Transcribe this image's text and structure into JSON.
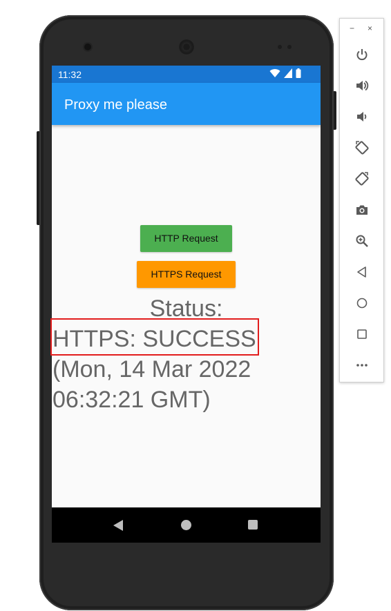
{
  "status_bar": {
    "time": "11:32"
  },
  "app_bar": {
    "title": "Proxy me please"
  },
  "buttons": {
    "http_label": "HTTP Request",
    "https_label": "HTTPS Request"
  },
  "status": {
    "label": "Status:",
    "result": "HTTPS: SUCCESS",
    "date_line_1": "(Mon, 14 Mar 2022",
    "date_line_2": "06:32:21 GMT)"
  },
  "colors": {
    "status_bar": "#1976d2",
    "app_bar": "#2196f3",
    "http_button": "#4caf50",
    "https_button": "#ff9800",
    "highlight": "#e21c1c"
  },
  "emulator_toolbar": {
    "window_controls": [
      "minimize",
      "close"
    ],
    "minimize_glyph": "−",
    "close_glyph": "×",
    "items": [
      {
        "name": "power-icon"
      },
      {
        "name": "volume-up-icon"
      },
      {
        "name": "volume-down-icon"
      },
      {
        "name": "rotate-left-icon"
      },
      {
        "name": "rotate-right-icon"
      },
      {
        "name": "camera-icon"
      },
      {
        "name": "zoom-icon"
      },
      {
        "name": "back-icon"
      },
      {
        "name": "home-icon"
      },
      {
        "name": "overview-icon"
      },
      {
        "name": "more-icon"
      }
    ]
  },
  "nav_bar": {
    "buttons": [
      "back-icon",
      "home-icon",
      "recents-icon"
    ]
  }
}
